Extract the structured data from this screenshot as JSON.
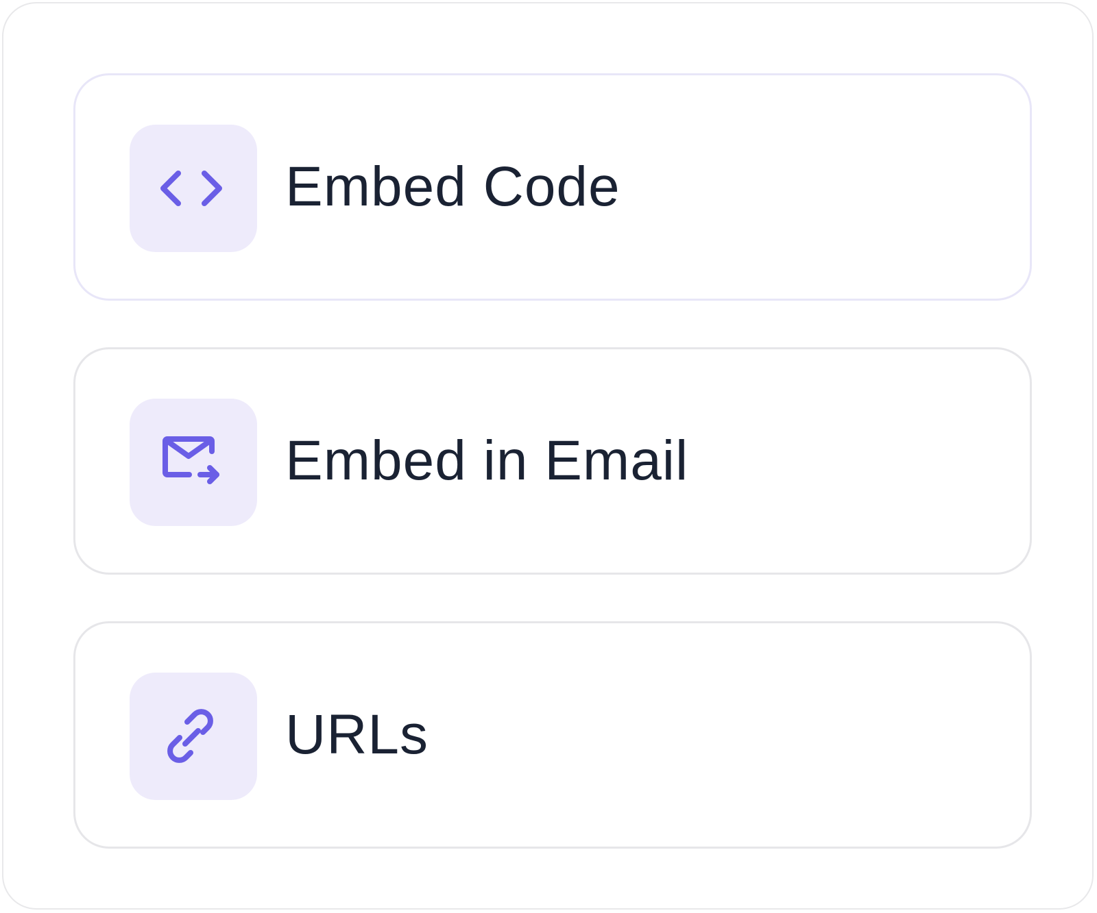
{
  "options": [
    {
      "label": "Embed Code",
      "icon": "code-icon",
      "selected": true
    },
    {
      "label": "Embed in Email",
      "icon": "email-forward-icon",
      "selected": false
    },
    {
      "label": "URLs",
      "icon": "link-icon",
      "selected": false
    }
  ],
  "colors": {
    "accent": "#6a5ee6",
    "icon_tile_bg": "#eeebfb",
    "text": "#1a2233",
    "card_border": "#e6e6e9",
    "selected_card_border": "#e8e6f8"
  }
}
